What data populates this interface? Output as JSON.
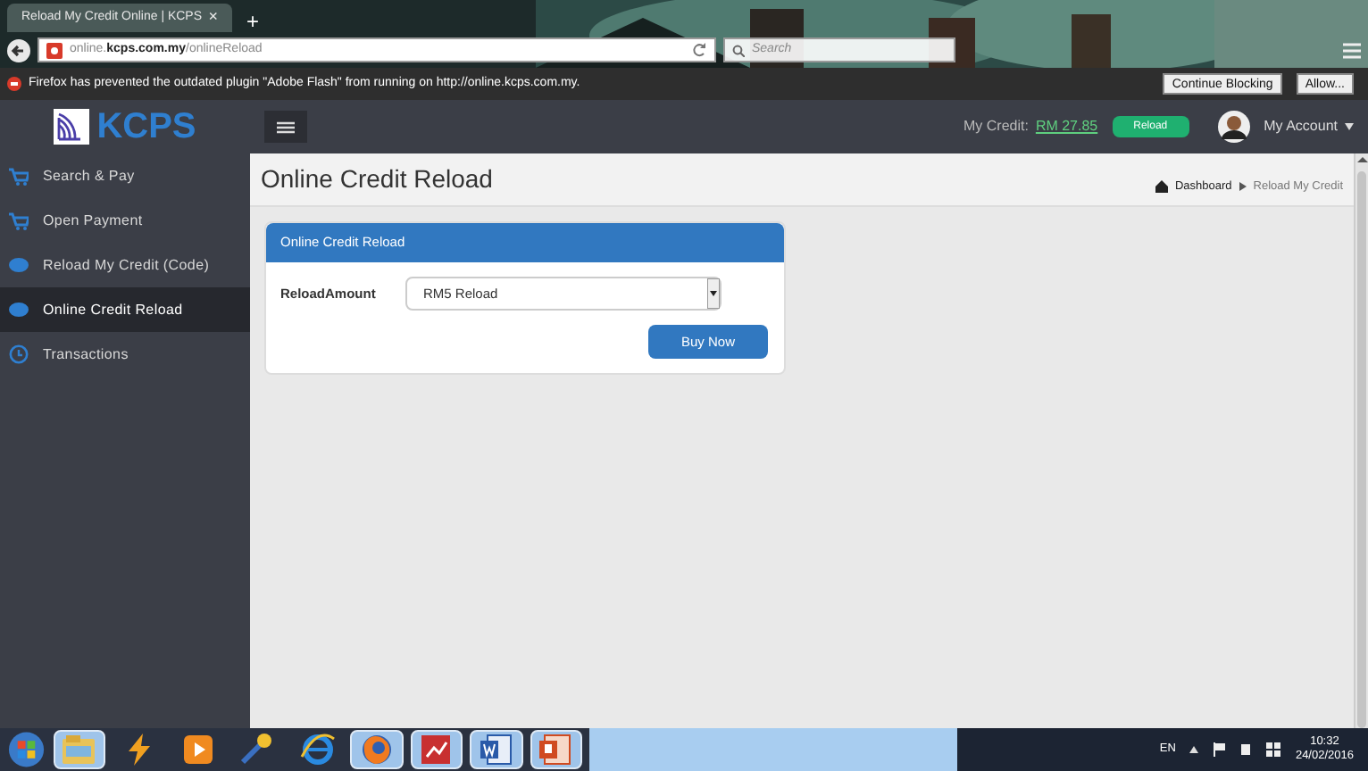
{
  "browser": {
    "tab_title": "Reload My Credit Online | KCPS",
    "tab_close": "×",
    "new_tab": "+",
    "url_prefix": "online.",
    "url_domain": "kcps.com.my",
    "url_path": "/onlineReload",
    "search_placeholder": "Search"
  },
  "notification": {
    "text": "Firefox has prevented the outdated plugin \"Adobe Flash\" from running on http://online.kcps.com.my.",
    "buttons": [
      "Continue Blocking",
      "Allow..."
    ]
  },
  "app": {
    "logo": "KCPS",
    "credit_label": "My Credit:",
    "credit_value": "RM 27.85",
    "reload_button": "Reload",
    "account": "My Account"
  },
  "sidebar": {
    "items": [
      {
        "label": "Search & Pay",
        "kind": "cart",
        "selected": false
      },
      {
        "label": "Open Payment",
        "kind": "cart",
        "selected": false
      },
      {
        "label": "Reload My Credit (Code)",
        "kind": "blob",
        "selected": false
      },
      {
        "label": "Online Credit Reload",
        "kind": "blob",
        "selected": true
      },
      {
        "label": "Transactions",
        "kind": "clock",
        "selected": false
      }
    ]
  },
  "page": {
    "title": "Online Credit Reload",
    "breadcrumb": [
      "Dashboard",
      "Reload My Credit"
    ]
  },
  "panel": {
    "heading": "Online Credit Reload",
    "field_label": "ReloadAmount",
    "field_value": "RM5 Reload",
    "button": "Buy Now"
  },
  "taskbar": {
    "apps": [
      {
        "kind": "folder",
        "open": true
      },
      {
        "kind": "bolt",
        "open": false
      },
      {
        "kind": "player",
        "open": false
      },
      {
        "kind": "tool",
        "open": false
      },
      {
        "kind": "ie",
        "open": false
      },
      {
        "kind": "firefox",
        "open": true
      },
      {
        "kind": "chart",
        "open": true
      },
      {
        "kind": "word",
        "open": true
      },
      {
        "kind": "slides",
        "open": true
      }
    ],
    "language": "EN",
    "time": "10:32",
    "date": "24/02/2016"
  }
}
